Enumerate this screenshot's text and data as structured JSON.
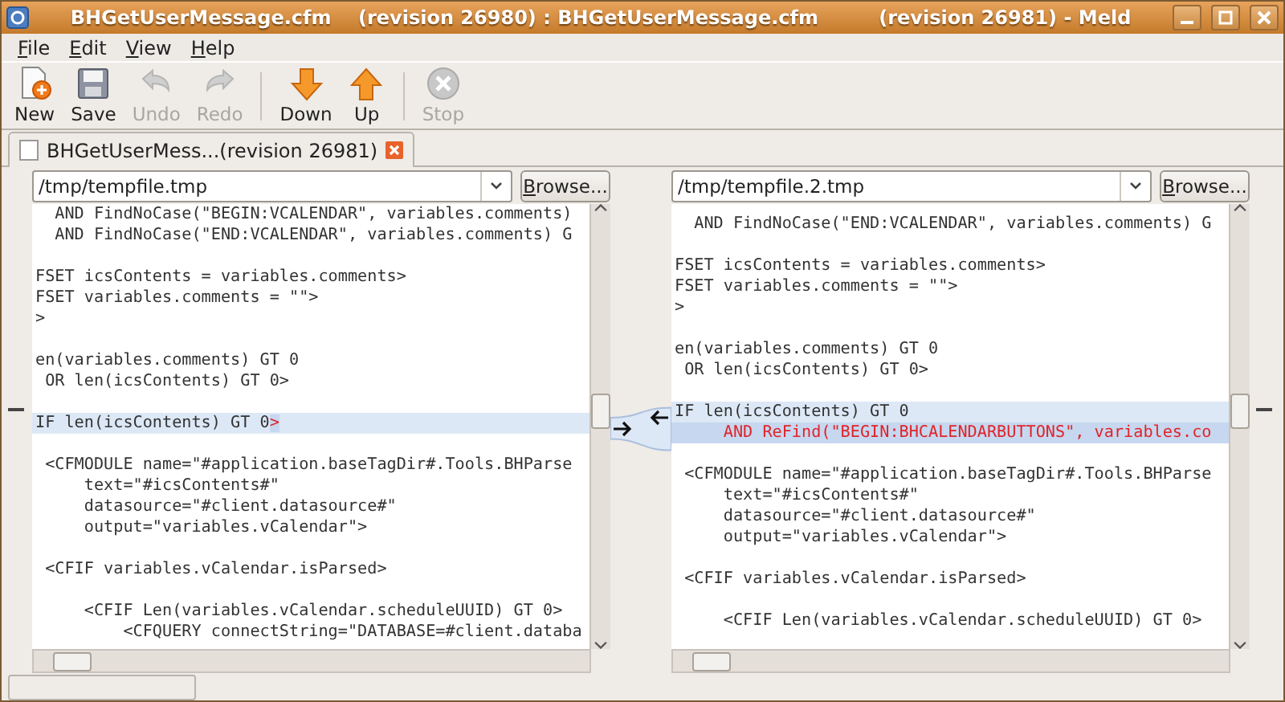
{
  "window": {
    "title": "BHGetUserMessage.cfm    (revision 26980) : BHGetUserMessage.cfm         (revision 26981) - Meld"
  },
  "menu": [
    "File",
    "Edit",
    "View",
    "Help"
  ],
  "toolbar": [
    {
      "kind": "new",
      "label": "New",
      "disabled": false
    },
    {
      "kind": "save",
      "label": "Save",
      "disabled": false
    },
    {
      "kind": "undo",
      "label": "Undo",
      "disabled": true
    },
    {
      "kind": "redo",
      "label": "Redo",
      "disabled": true
    },
    {
      "kind": "separator"
    },
    {
      "kind": "down",
      "label": "Down",
      "disabled": false
    },
    {
      "kind": "up",
      "label": "Up",
      "disabled": false
    },
    {
      "kind": "separator"
    },
    {
      "kind": "stop",
      "label": "Stop",
      "disabled": true
    }
  ],
  "tab": {
    "label": "BHGetUserMess...(revision 26981)",
    "selected": true
  },
  "panes": [
    {
      "path": "/tmp/tempfile.tmp",
      "browse": "Browse...",
      "lines": [
        {
          "kind": "plain",
          "text": "  AND FindNoCase(\"BEGIN:VCALENDAR\", variables.comments)"
        },
        {
          "kind": "plain",
          "text": "  AND FindNoCase(\"END:VCALENDAR\", variables.comments) G"
        },
        {
          "kind": "blank"
        },
        {
          "kind": "plain",
          "text": "FSET icsContents = variables.comments>"
        },
        {
          "kind": "plain",
          "text": "FSET variables.comments = \"\">"
        },
        {
          "kind": "plain",
          "text": ">"
        },
        {
          "kind": "blank"
        },
        {
          "kind": "plain",
          "text": "en(variables.comments) GT 0"
        },
        {
          "kind": "plain",
          "text": " OR len(icsContents) GT 0>"
        },
        {
          "kind": "blank"
        },
        {
          "kind": "changed",
          "text": "IF len(icsContents) GT 0",
          "changed_text": ">"
        },
        {
          "kind": "blank"
        },
        {
          "kind": "plain",
          "text": " <CFMODULE name=\"#application.baseTagDir#.Tools.BHParse"
        },
        {
          "kind": "plain",
          "text": "     text=\"#icsContents#\""
        },
        {
          "kind": "plain",
          "text": "     datasource=\"#client.datasource#\""
        },
        {
          "kind": "plain",
          "text": "     output=\"variables.vCalendar\">"
        },
        {
          "kind": "blank"
        },
        {
          "kind": "plain",
          "text": " <CFIF variables.vCalendar.isParsed>"
        },
        {
          "kind": "blank"
        },
        {
          "kind": "plain",
          "text": "     <CFIF Len(variables.vCalendar.scheduleUUID) GT 0>"
        },
        {
          "kind": "plain",
          "text": "         <CFQUERY connectString=\"DATABASE=#client.databa"
        }
      ]
    },
    {
      "path": "/tmp/tempfile.2.tmp",
      "browse": "Browse...",
      "lines": [
        {
          "kind": "plain",
          "text": "  AND FindNoCase(\"END:VCALENDAR\", variables.comments) G"
        },
        {
          "kind": "blank"
        },
        {
          "kind": "plain",
          "text": "FSET icsContents = variables.comments>"
        },
        {
          "kind": "plain",
          "text": "FSET variables.comments = \"\">"
        },
        {
          "kind": "plain",
          "text": ">"
        },
        {
          "kind": "blank"
        },
        {
          "kind": "plain",
          "text": "en(variables.comments) GT 0"
        },
        {
          "kind": "plain",
          "text": " OR len(icsContents) GT 0>"
        },
        {
          "kind": "blank"
        },
        {
          "kind": "changed",
          "text": "IF len(icsContents) GT 0"
        },
        {
          "kind": "inserted",
          "text": "     AND ReFind(\"BEGIN:BHCALENDARBUTTONS\", variables.co"
        },
        {
          "kind": "blank"
        },
        {
          "kind": "plain",
          "text": " <CFMODULE name=\"#application.baseTagDir#.Tools.BHParse"
        },
        {
          "kind": "plain",
          "text": "     text=\"#icsContents#\""
        },
        {
          "kind": "plain",
          "text": "     datasource=\"#client.datasource#\""
        },
        {
          "kind": "plain",
          "text": "     output=\"variables.vCalendar\">"
        },
        {
          "kind": "blank"
        },
        {
          "kind": "plain",
          "text": " <CFIF variables.vCalendar.isParsed>"
        },
        {
          "kind": "blank"
        },
        {
          "kind": "plain",
          "text": "     <CFIF Len(variables.vCalendar.scheduleUUID) GT 0>"
        }
      ]
    }
  ]
}
